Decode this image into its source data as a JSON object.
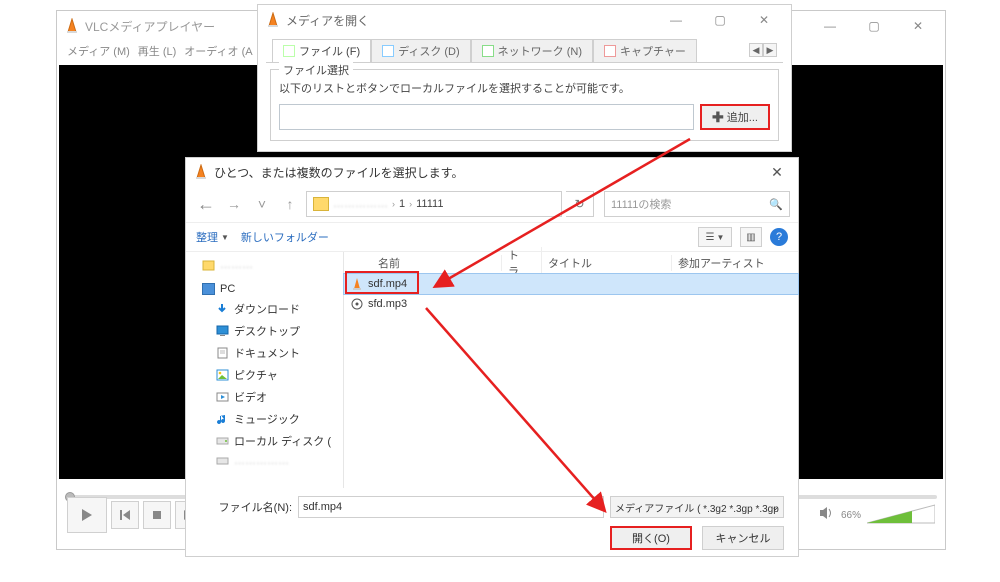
{
  "vlc_main": {
    "title": "VLCメディアプレイヤー",
    "menu": {
      "media": "メディア (M)",
      "playback": "再生 (L)",
      "audio": "オーディオ (A"
    },
    "volume_percent": "66%"
  },
  "open_media": {
    "title": "メディアを開く",
    "tabs": {
      "file": "ファイル (F)",
      "disc": "ディスク (D)",
      "network": "ネットワーク (N)",
      "capture": "キャプチャー"
    },
    "file_section": {
      "legend": "ファイル選択",
      "desc": "以下のリストとボタンでローカルファイルを選択することが可能です。",
      "add_btn": "追加..."
    }
  },
  "file_dialog": {
    "title": "ひとつ、または複数のファイルを選択します。",
    "breadcrumb": {
      "part1": "1",
      "part2": "11111"
    },
    "search_placeholder": "11111の検索",
    "toolbar": {
      "organize": "整理",
      "new_folder": "新しいフォルダー"
    },
    "tree": {
      "pc": "PC",
      "downloads": "ダウンロード",
      "desktop": "デスクトップ",
      "documents": "ドキュメント",
      "pictures": "ピクチャ",
      "videos": "ビデオ",
      "music": "ミュージック",
      "localdisk": "ローカル ディスク ("
    },
    "columns": {
      "name": "名前",
      "track": "トラ...",
      "title": "タイトル",
      "artist": "参加アーティスト"
    },
    "rows": [
      {
        "name": "sdf.mp4",
        "selected": true,
        "icon": "cone"
      },
      {
        "name": "sfd.mp3",
        "selected": false,
        "icon": "disc"
      }
    ],
    "filename_label": "ファイル名(N):",
    "filename_value": "sdf.mp4",
    "filter": "メディアファイル ( *.3g2 *.3gp *.3gp",
    "open_btn": "開く(O)",
    "cancel_btn": "キャンセル"
  }
}
